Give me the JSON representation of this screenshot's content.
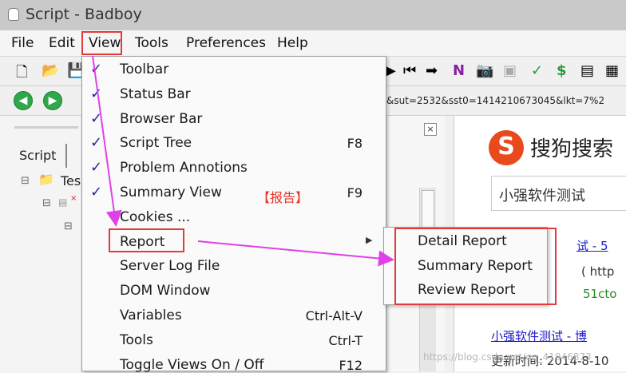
{
  "window": {
    "title": "Script - Badboy"
  },
  "menubar": [
    "File",
    "Edit",
    "View",
    "Tools",
    "Preferences",
    "Help"
  ],
  "toolbar": {
    "url": "&sut=2532&sst0=1414210673045&lkt=7%2"
  },
  "left_pane": {
    "tab_label": "Script",
    "tree_root": "Tes"
  },
  "browser": {
    "logo_text": "搜狗搜索",
    "search_value": "小强软件测试",
    "result_fragments": [
      "试 - 5",
      "( http",
      "51cto",
      "小强软件测试 - 博",
      "更新时间: 2014-8-10"
    ]
  },
  "view_menu": {
    "items": [
      {
        "label": "Toolbar",
        "checked": true,
        "shortcut": ""
      },
      {
        "label": "Status Bar",
        "checked": true,
        "shortcut": ""
      },
      {
        "label": "Browser Bar",
        "checked": true,
        "shortcut": ""
      },
      {
        "label": "Script Tree",
        "checked": true,
        "shortcut": "F8"
      },
      {
        "label": "Problem Annotions",
        "checked": true,
        "shortcut": ""
      },
      {
        "label": "Summary View",
        "checked": true,
        "shortcut": "F9"
      },
      {
        "label": "Cookies ...",
        "checked": false,
        "shortcut": ""
      },
      {
        "label": "Report",
        "checked": false,
        "shortcut": ""
      },
      {
        "label": "Server Log File",
        "checked": false,
        "shortcut": ""
      },
      {
        "label": "DOM Window",
        "checked": false,
        "shortcut": ""
      },
      {
        "label": "Variables",
        "checked": false,
        "shortcut": "Ctrl-Alt-V"
      },
      {
        "label": "Tools",
        "checked": false,
        "shortcut": "Ctrl-T"
      },
      {
        "label": "Toggle Views On / Off",
        "checked": false,
        "shortcut": "F12"
      }
    ],
    "annotation": "【报告】"
  },
  "report_submenu": [
    "Detail Report",
    "Summary Report",
    "Review Report"
  ],
  "watermark": "https://blog.csdn.net/qq_41946873",
  "colors": {
    "highlight_box": "#e23b3b",
    "arrow": "#e040e8",
    "check": "#1f2c9c"
  }
}
